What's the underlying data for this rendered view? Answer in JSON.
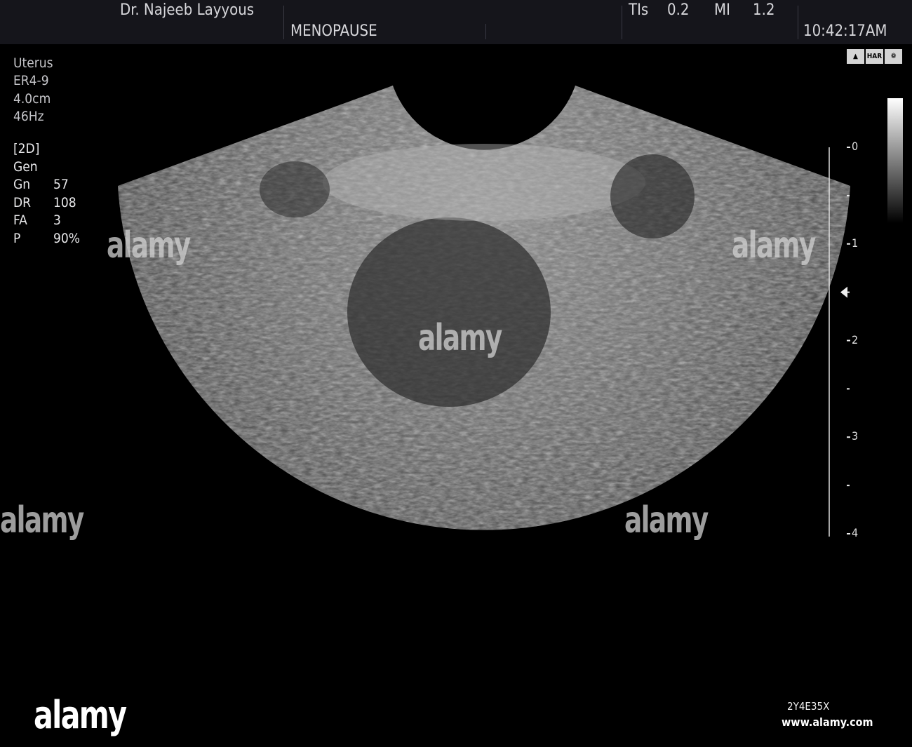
{
  "header": {
    "operator": "Dr. Najeeb Layyous",
    "preset": "MENOPAUSE",
    "tis_label": "TIs",
    "tis_value": "0.2",
    "mi_label": "MI",
    "mi_value": "1.2",
    "time": "10:42:17AM"
  },
  "exam": {
    "organ": "Uterus",
    "probe": "ER4-9",
    "depth": "4.0cm",
    "frame_rate": "46Hz"
  },
  "params": {
    "mode": "[2D]",
    "freq": "Gen",
    "rows": [
      {
        "label": "Gn",
        "value": "57"
      },
      {
        "label": "DR",
        "value": "108"
      },
      {
        "label": "FA",
        "value": "3"
      },
      {
        "label": "P",
        "value": "90%"
      }
    ]
  },
  "mode_icons": [
    "probe-icon",
    "HAR",
    "cine-icon"
  ],
  "depth_scale": {
    "labels": [
      "0",
      "1",
      "2",
      "3",
      "4"
    ],
    "focus_depth_cm": 1.5
  },
  "watermark": {
    "brand": "alamy",
    "image_id": "2Y4E35X",
    "site": "www.alamy.com"
  }
}
